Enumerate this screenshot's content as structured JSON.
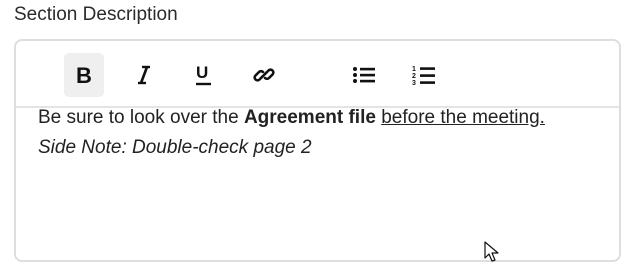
{
  "field": {
    "label": "Section Description"
  },
  "toolbar": {
    "buttons": [
      {
        "name": "bold",
        "icon": "bold-icon",
        "active": true
      },
      {
        "name": "italic",
        "icon": "italic-icon",
        "active": false
      },
      {
        "name": "underline",
        "icon": "underline-icon",
        "active": false
      },
      {
        "name": "link",
        "icon": "link-icon",
        "active": false
      },
      {
        "name": "bulleted-list",
        "icon": "bulleted-list-icon",
        "active": false
      },
      {
        "name": "numbered-list",
        "icon": "numbered-list-icon",
        "active": false
      }
    ],
    "active_bg": "#efefef"
  },
  "content": {
    "line1_text": "Be sure to look over the ",
    "line1_bold": "Agreement file",
    "line1_space": " ",
    "line1_underline": "before the meeting.",
    "line2_italic": "Side Note: Double-check page 2"
  },
  "colors": {
    "border": "#dedede",
    "text": "#222222"
  }
}
